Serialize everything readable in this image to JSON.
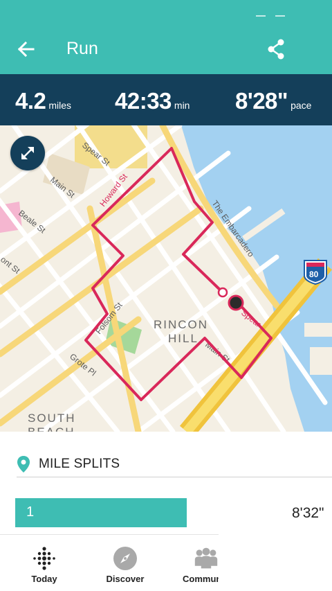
{
  "header": {
    "title": "Run",
    "bg_color": "#3ebdb3",
    "back_icon": "arrow-left-icon",
    "share_icon": "share-icon"
  },
  "stats": {
    "distance": {
      "value": "4.2",
      "unit": "miles"
    },
    "duration": {
      "value": "42:33",
      "unit": "min"
    },
    "pace": {
      "value": "8'28\"",
      "unit": "pace"
    },
    "bg_color": "#143f5a"
  },
  "map": {
    "expand_icon": "expand-arrows-icon",
    "route_color": "#d9285a",
    "labels": {
      "spear": "Spear St",
      "howard": "Howard St",
      "main": "Main St",
      "beale": "Beale St",
      "fremont": "ont St",
      "embarcadero": "The Embarcadero",
      "folsom": "Folsom St",
      "rincon1": "RINCON",
      "rincon2": "HILL",
      "grote": "Grote Pl",
      "south1": "SOUTH",
      "south2": "BEACH",
      "spear2": "Spear",
      "main2": "Main St",
      "i80": "80"
    }
  },
  "splits": {
    "header": "MILE SPLITS",
    "rows": [
      {
        "mile": "1",
        "pace": "8'32\""
      }
    ]
  },
  "bottom_nav": [
    {
      "label": "Today",
      "icon": "dots-grid-icon"
    },
    {
      "label": "Discover",
      "icon": "compass-icon"
    },
    {
      "label": "Commun",
      "icon": "community-icon"
    }
  ]
}
